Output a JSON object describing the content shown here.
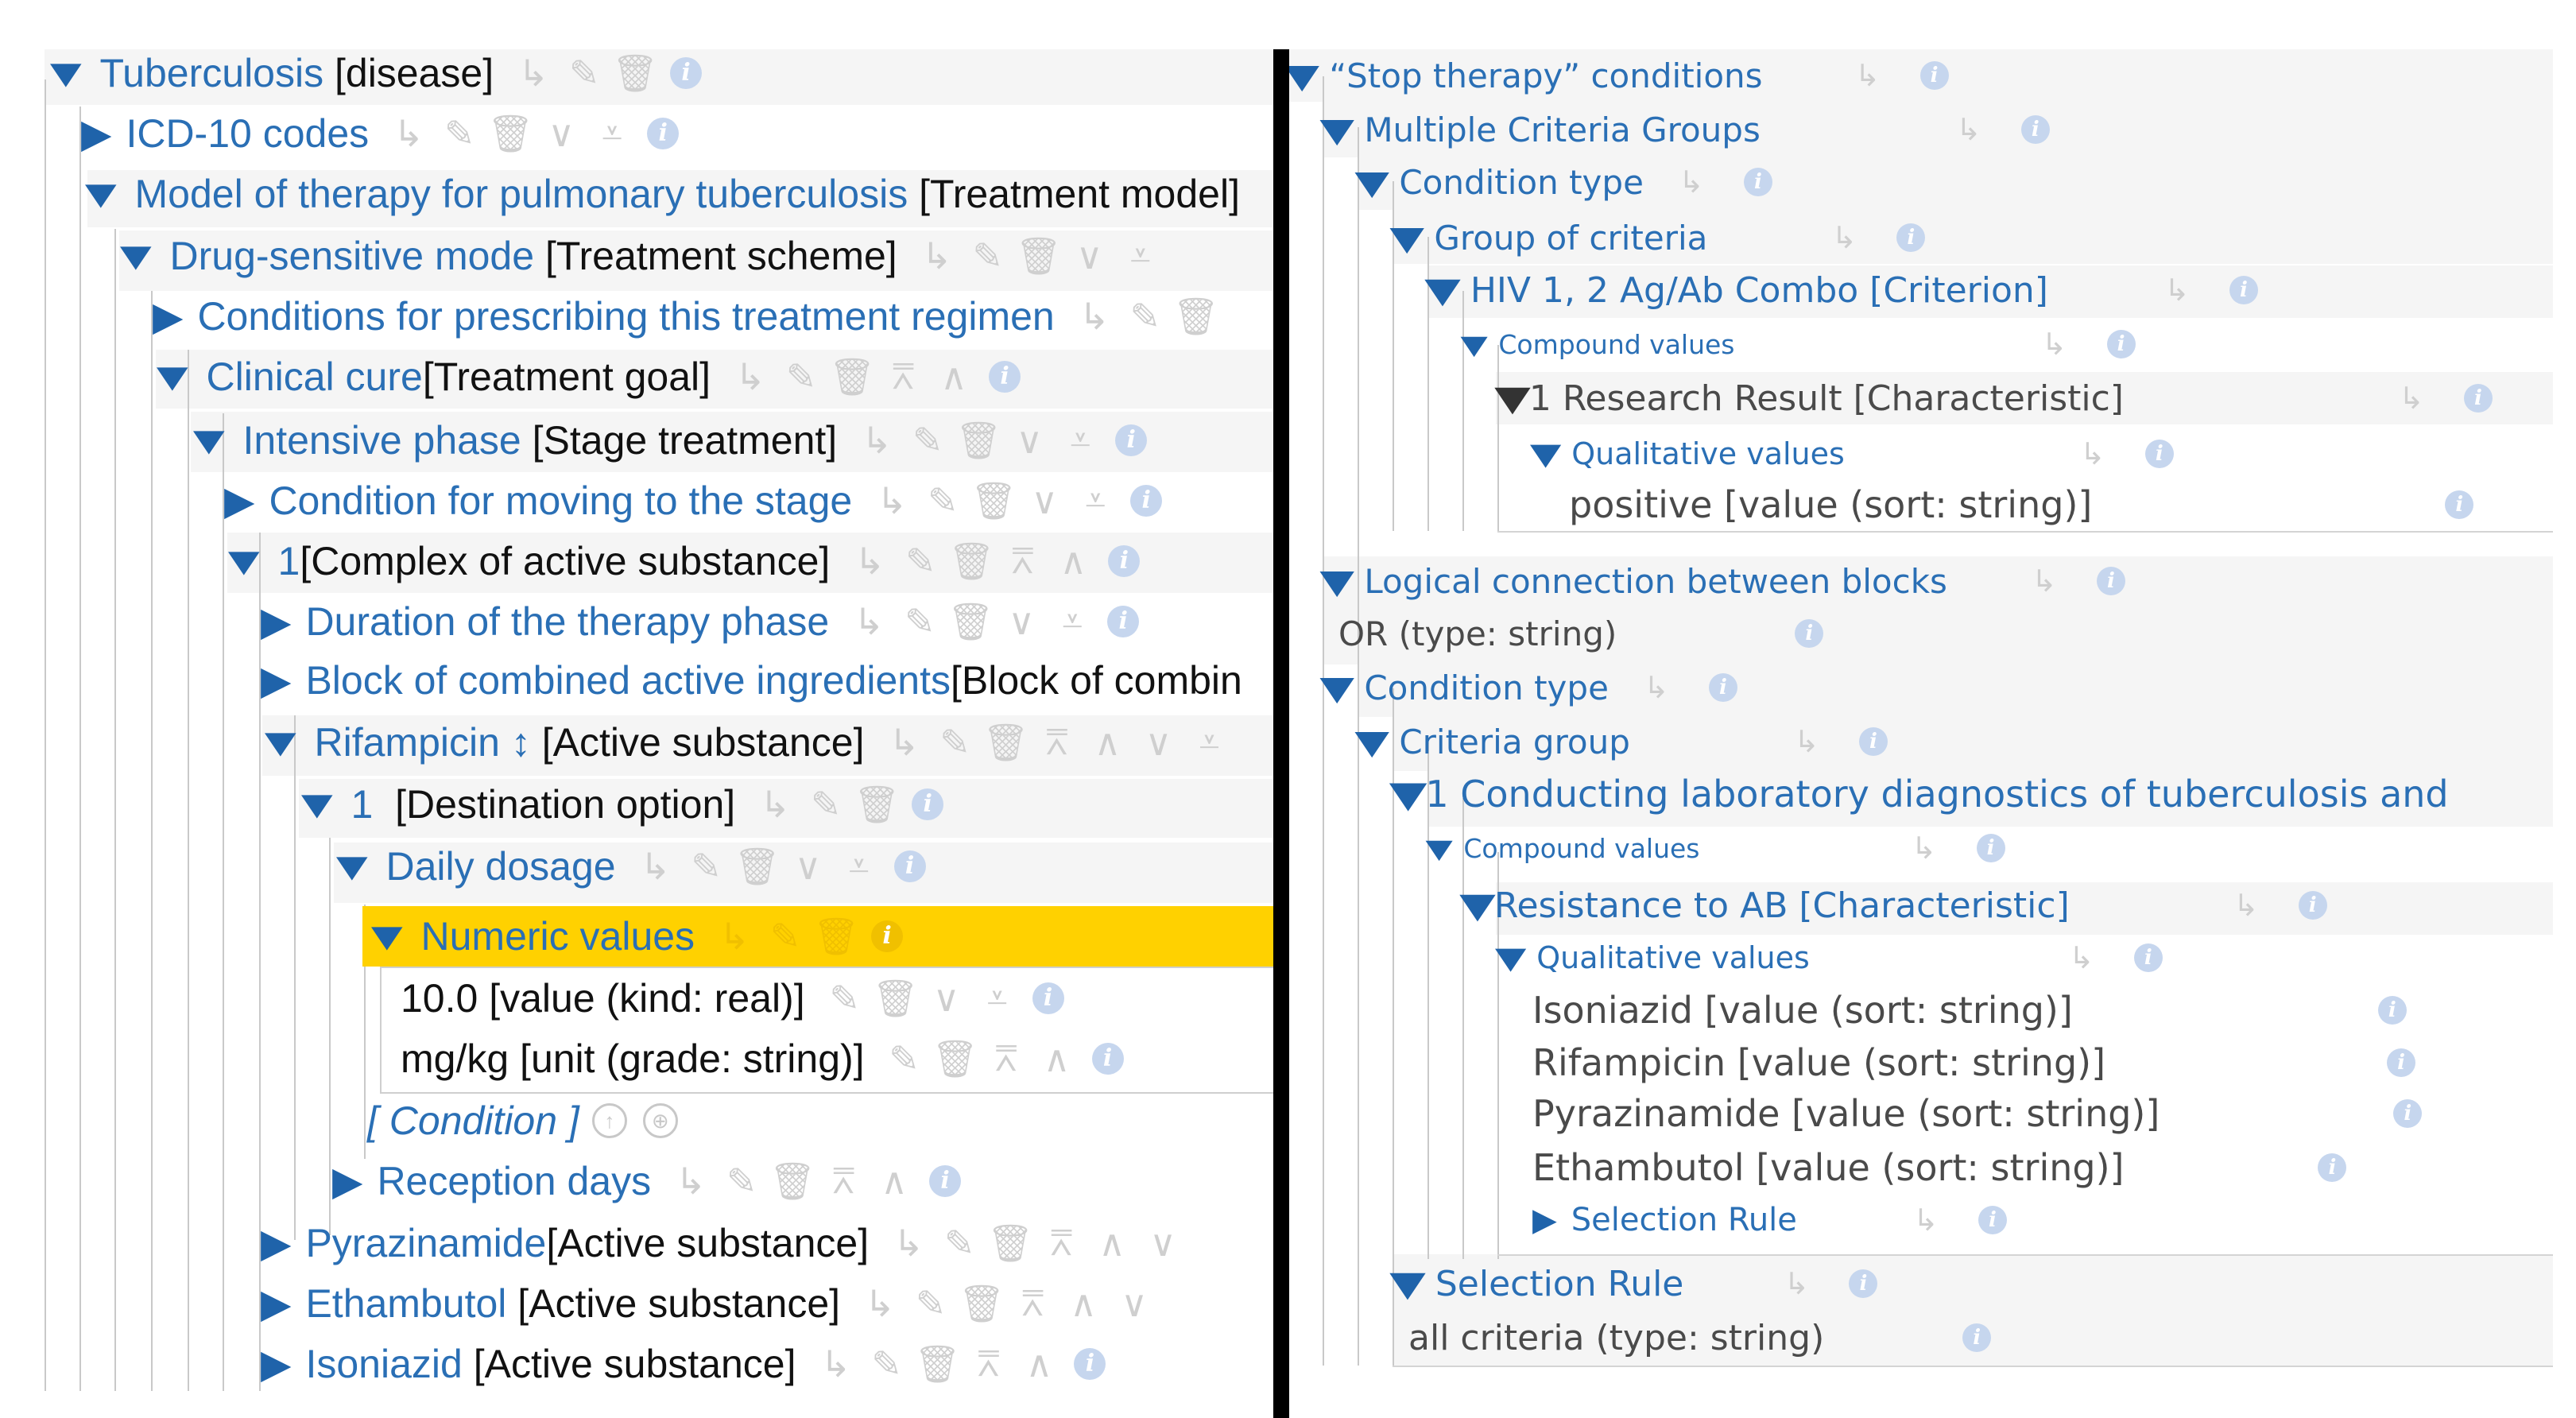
{
  "left": {
    "rows": [
      {
        "label": "Tuberculosis",
        "type": "[disease]"
      },
      {
        "label": "ICD-10 codes",
        "type": ""
      },
      {
        "label": "Model of therapy for pulmonary tuberculosis",
        "type": "[Treatment model]"
      },
      {
        "label": "Drug-sensitive mode",
        "type": "[Treatment scheme]"
      },
      {
        "label": "Conditions for prescribing this treatment regimen",
        "type": ""
      },
      {
        "label": "Clinical cure",
        "type": "[Treatment goal]"
      },
      {
        "label": "Intensive phase",
        "type": "[Stage treatment]"
      },
      {
        "label": "Condition for moving to the stage",
        "type": ""
      },
      {
        "label": "1",
        "type": "[Complex of active substance]"
      },
      {
        "label": "Duration of the therapy phase",
        "type": ""
      },
      {
        "label": "Block of combined active ingredients",
        "type": "[Block of combin"
      },
      {
        "label": "Rifampicin",
        "type": "[Active substance]"
      },
      {
        "label": "1",
        "type": "[Destination option]"
      },
      {
        "label": "Daily dosage",
        "type": ""
      },
      {
        "label": "Numeric values",
        "type": ""
      },
      {
        "label": "10.0 [value (kind: real)]",
        "type": ""
      },
      {
        "label": "mg/kg [unit (grade: string)]",
        "type": ""
      },
      {
        "label": "[ Condition ]",
        "type": ""
      },
      {
        "label": "Reception days",
        "type": ""
      },
      {
        "label": "Pyrazinamide",
        "type": "[Active substance]"
      },
      {
        "label": "Ethambutol",
        "type": "[Active substance]"
      },
      {
        "label": "Isoniazid",
        "type": "[Active substance]"
      }
    ]
  },
  "right": {
    "rows": [
      {
        "label": "“Stop therapy” conditions"
      },
      {
        "label": "Multiple Criteria Groups"
      },
      {
        "label": "Condition type"
      },
      {
        "label": "Group of criteria"
      },
      {
        "label": "HIV 1, 2 Ag/Ab Combo [Criterion]"
      },
      {
        "label": "Compound values"
      },
      {
        "label": "1 Research Result [Characteristic]"
      },
      {
        "label": "Qualitative values"
      },
      {
        "label": "positive [value (sort: string)]"
      },
      {
        "label": "Logical connection between blocks"
      },
      {
        "label": "OR (type: string)"
      },
      {
        "label": "Condition type"
      },
      {
        "label": "Criteria group"
      },
      {
        "label": "1 Conducting laboratory diagnostics of tuberculosis and"
      },
      {
        "label": "Compound values"
      },
      {
        "label": "Resistance to AB [Characteristic]"
      },
      {
        "label": "Qualitative values"
      },
      {
        "label": "Isoniazid [value (sort: string)]"
      },
      {
        "label": "Rifampicin [value (sort: string)]"
      },
      {
        "label": "Pyrazinamide [value (sort: string)]"
      },
      {
        "label": "Ethambutol [value (sort: string)]"
      },
      {
        "label": "Selection Rule"
      },
      {
        "label": "Selection Rule"
      },
      {
        "label": "all criteria (type: string)"
      }
    ]
  },
  "icons": {
    "toggle_down": "▼",
    "toggle_right": "▶",
    "sort_arrows": "↕",
    "link": "↳",
    "edit": "✎",
    "delete": "🗑",
    "chevron_down": "∨",
    "move_bottom": "⩡",
    "move_top": "⩞",
    "chevron_up": "∧",
    "info": "i",
    "up": "↑",
    "copy": "⊕"
  },
  "colors": {
    "label": "#2a6fb5",
    "selected": "#ffd100",
    "divider": "#000000"
  }
}
